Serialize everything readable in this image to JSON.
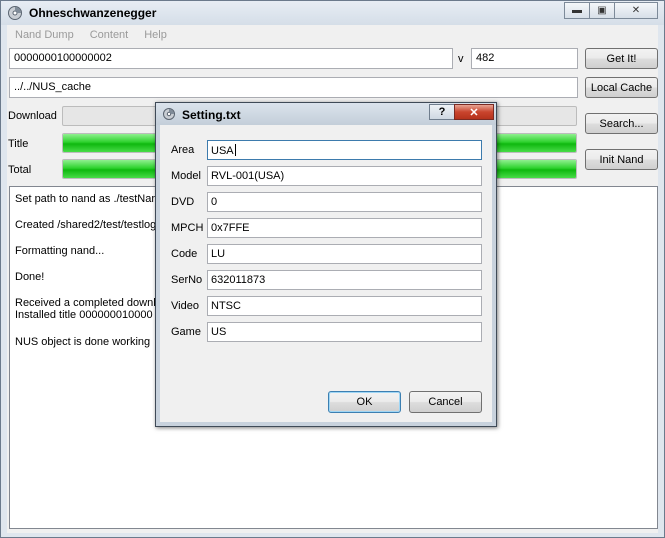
{
  "window": {
    "title": "Ohneschwanzenegger",
    "caption_minimize": "▬",
    "caption_maximize": "▣",
    "caption_close": "✕"
  },
  "menu": [
    {
      "label": "Nand Dump"
    },
    {
      "label": "Content"
    },
    {
      "label": "Help"
    }
  ],
  "title_id": {
    "value": "0000000100000002"
  },
  "version": {
    "label": "v",
    "value": "482"
  },
  "get_it_button": "Get It!",
  "cache_path": {
    "value": "../../NUS_cache"
  },
  "local_cache_button": "Local Cache",
  "download_label": "Download",
  "title_label": "Title",
  "total_label": "Total",
  "search_button": "Search...",
  "init_nand_button": "Init Nand",
  "progress": {
    "download": 0,
    "title": 100,
    "total": 100
  },
  "log": [
    "Set path to nand as ./testNar",
    "Created /shared2/test/testlog",
    "Formatting nand...",
    "Done!",
    "Received a completed downlo",
    "Installed title 000000010000",
    "NUS object is done working"
  ],
  "dialog": {
    "title": "Setting.txt",
    "help_button": "?",
    "close_button": "✕",
    "fields": [
      {
        "label": "Area",
        "value": "USA"
      },
      {
        "label": "Model",
        "value": "RVL-001(USA)"
      },
      {
        "label": "DVD",
        "value": "0"
      },
      {
        "label": "MPCH",
        "value": "0x7FFE"
      },
      {
        "label": "Code",
        "value": "LU"
      },
      {
        "label": "SerNo",
        "value": "632011873"
      },
      {
        "label": "Video",
        "value": "NTSC"
      },
      {
        "label": "Game",
        "value": "US"
      }
    ],
    "ok_button": "OK",
    "cancel_button": "Cancel"
  },
  "icons": {
    "app": "app-disc-icon",
    "dialog": "dialog-disc-icon"
  }
}
